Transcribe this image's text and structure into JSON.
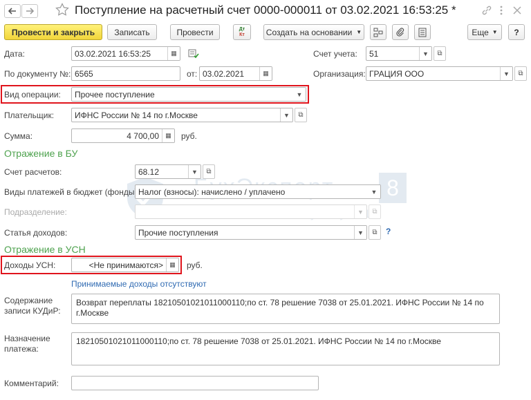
{
  "window": {
    "title": "Поступление на расчетный счет 0000-000011 от 03.02.2021 16:53:25 *"
  },
  "toolbar": {
    "post_close": "Провести и закрыть",
    "save": "Записать",
    "post": "Провести",
    "dt_kt_top": "Дт",
    "dt_kt_bottom": "Кт",
    "create_based": "Создать на основании",
    "more": "Еще",
    "help": "?"
  },
  "form": {
    "date_label": "Дата:",
    "date_value": "03.02.2021 16:53:25",
    "account_label": "Счет учета:",
    "account_value": "51",
    "doc_label": "По документу №:",
    "doc_value": "6565",
    "doc_from_label": "от:",
    "doc_from_value": "03.02.2021",
    "org_label": "Организация:",
    "org_value": "ГРАЦИЯ ООО",
    "op_label": "Вид операции:",
    "op_value": "Прочее поступление",
    "payer_label": "Плательщик:",
    "payer_value": "ИФНС России № 14 по г.Москве",
    "sum_label": "Сумма:",
    "sum_value": "4 700,00",
    "currency": "руб."
  },
  "bu": {
    "section_title": "Отражение в БУ",
    "settle_label": "Счет расчетов:",
    "settle_value": "68.12",
    "budget_label": "Виды платежей в бюджет (фонды):",
    "budget_value": "Налог (взносы): начислено / уплачено",
    "division_label": "Подразделение:",
    "division_value": "",
    "income_label": "Статья доходов:",
    "income_value": "Прочие поступления",
    "income_help": "?"
  },
  "usn": {
    "section_title": "Отражение в УСН",
    "income_label": "Доходы УСН:",
    "income_value": "<Не принимаются>",
    "currency": "руб.",
    "link_text": "Принимаемые доходы отсутствуют",
    "kudir_label_1": "Содержание",
    "kudir_label_2": "записи КУДиР:",
    "kudir_value": "Возврат переплаты 18210501021011000110;по ст. 78 решение 7038 от 25.01.2021. ИФНС России № 14 по г.Москве",
    "purpose_label_1": "Назначение",
    "purpose_label_2": "платежа:",
    "purpose_value": "18210501021011000110;по ст. 78 решение 7038 от 25.01.2021. ИФНС России № 14 по г.Москве",
    "comment_label": "Комментарий:",
    "comment_value": ""
  },
  "watermark": {
    "title": "БухЭксперт",
    "number": "8",
    "subtitle": "База ответов по учету в 1С"
  },
  "colors": {
    "accent_green": "#4ea24e",
    "highlight_red": "#e0141c",
    "primary_yellow": "#f2d53a",
    "link_blue": "#2f6ab2"
  }
}
